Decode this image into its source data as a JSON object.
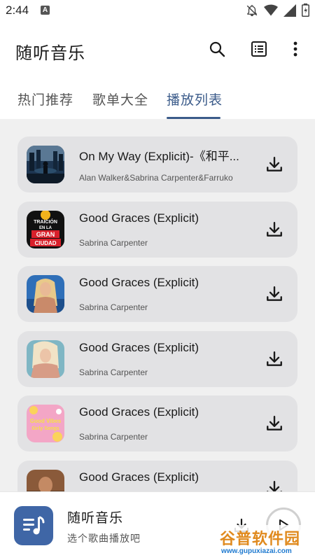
{
  "status_bar": {
    "time": "2:44",
    "notification_icon": "a-icon",
    "icons": [
      "bell-off-icon",
      "wifi-icon",
      "signal-icon",
      "battery-icon"
    ]
  },
  "app_bar": {
    "title": "随听音乐",
    "actions": [
      "search-icon",
      "playlist-icon",
      "more-vert-icon"
    ]
  },
  "tabs": {
    "items": [
      {
        "label": "热门推荐",
        "active": false
      },
      {
        "label": "歌单大全",
        "active": false
      },
      {
        "label": "播放列表",
        "active": true
      }
    ],
    "active_color": "#3b5b8a"
  },
  "songs": [
    {
      "title": "On My Way (Explicit)-《和平...",
      "artist": "Alan Walker&Sabrina Carpenter&Farruko",
      "cover": "album-cover-dark-city"
    },
    {
      "title": "Good Graces (Explicit)",
      "artist": "Sabrina Carpenter",
      "cover": "album-cover-traicion",
      "cover_text": [
        "TRAICIÓN",
        "EN LA",
        "GRAN",
        "CIUDAD"
      ]
    },
    {
      "title": "Good Graces (Explicit)",
      "artist": "Sabrina Carpenter",
      "cover": "album-cover-blonde-blue"
    },
    {
      "title": "Good Graces (Explicit)",
      "artist": "Sabrina Carpenter",
      "cover": "album-cover-blonde-teal"
    },
    {
      "title": "Good Graces (Explicit)",
      "artist": "Sabrina Carpenter",
      "cover": "album-cover-good-vibes",
      "cover_text": [
        "Good Vibes",
        "Girly Songs"
      ]
    },
    {
      "title": "Good Graces (Explicit)",
      "artist": "",
      "cover": "album-cover-brown"
    }
  ],
  "player": {
    "name": "随听音乐",
    "subtitle": "选个歌曲播放吧",
    "logo_icon": "music-list-icon",
    "logo_color": "#3f66a6"
  },
  "watermark": {
    "main": "谷普软件园",
    "url": "www.gupuxiazai.com"
  },
  "colors": {
    "list_bg": "#f0f0f0",
    "card_bg": "#e2e2e4",
    "accent": "#3b5b8a"
  }
}
